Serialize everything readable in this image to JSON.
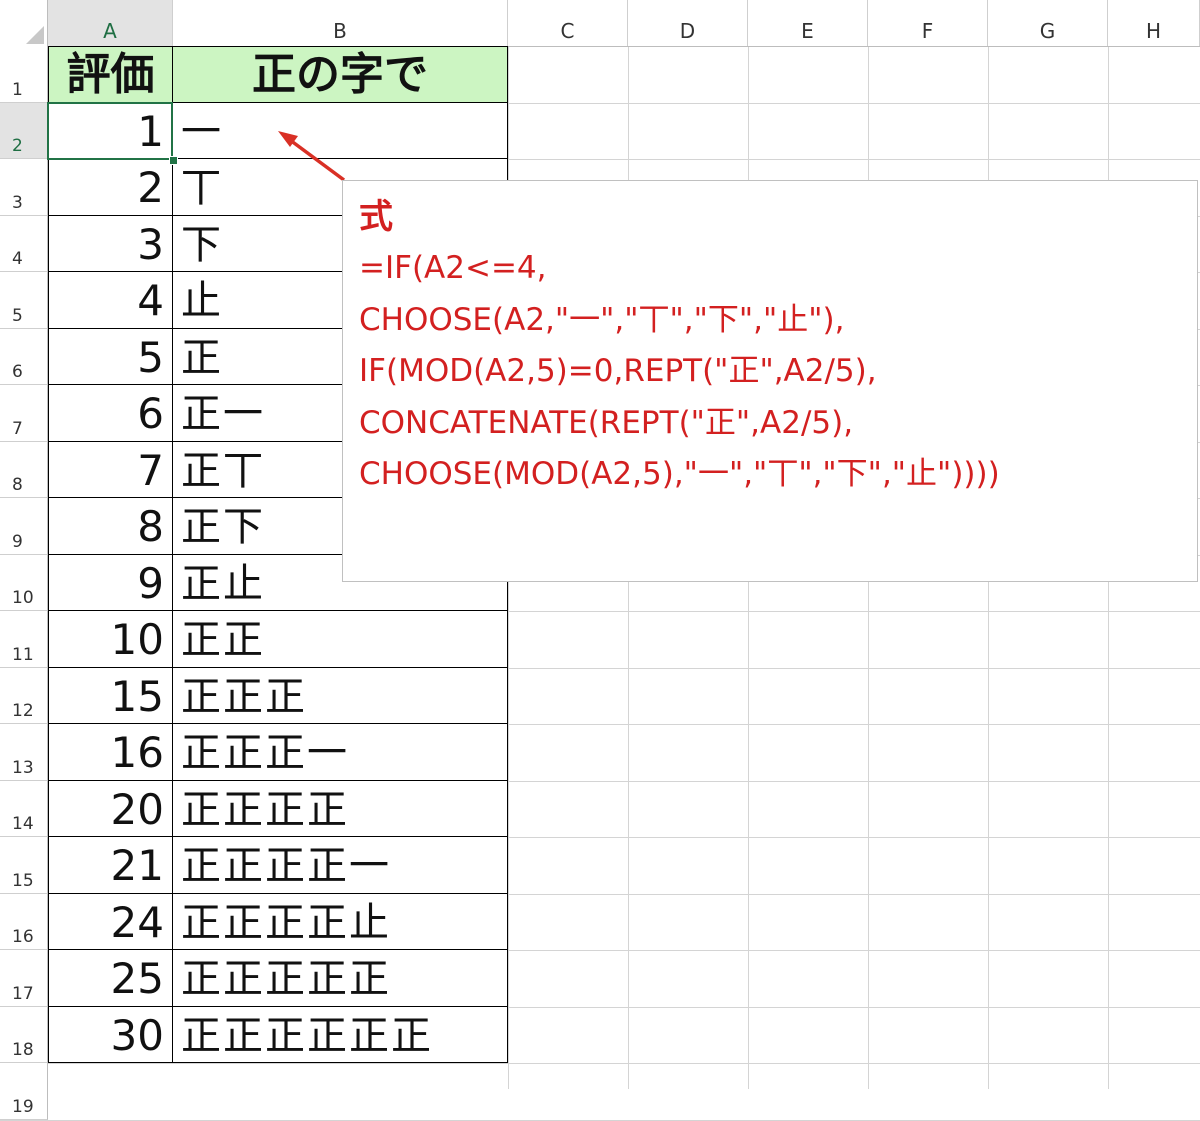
{
  "columns": [
    "A",
    "B",
    "C",
    "D",
    "E",
    "F",
    "G",
    "H"
  ],
  "rows": [
    "1",
    "2",
    "3",
    "4",
    "5",
    "6",
    "7",
    "8",
    "9",
    "10",
    "11",
    "12",
    "13",
    "14",
    "15",
    "16",
    "17",
    "18",
    "19"
  ],
  "table": {
    "header": {
      "rating": "評価",
      "tally": "正の字で"
    },
    "data": [
      {
        "value": "1",
        "tally": "一"
      },
      {
        "value": "2",
        "tally": "丅"
      },
      {
        "value": "3",
        "tally": "下"
      },
      {
        "value": "4",
        "tally": "止"
      },
      {
        "value": "5",
        "tally": "正"
      },
      {
        "value": "6",
        "tally": "正一"
      },
      {
        "value": "7",
        "tally": "正丅"
      },
      {
        "value": "8",
        "tally": "正下"
      },
      {
        "value": "9",
        "tally": "正止"
      },
      {
        "value": "10",
        "tally": "正正"
      },
      {
        "value": "15",
        "tally": "正正正"
      },
      {
        "value": "16",
        "tally": "正正正一"
      },
      {
        "value": "20",
        "tally": "正正正正"
      },
      {
        "value": "21",
        "tally": "正正正正一"
      },
      {
        "value": "24",
        "tally": "正正正正止"
      },
      {
        "value": "25",
        "tally": "正正正正正"
      },
      {
        "value": "30",
        "tally": "正正正正正正"
      }
    ]
  },
  "annotation": {
    "title": "式",
    "lines": [
      "=IF(A2<=4,",
      "CHOOSE(A2,\"一\",\"丅\",\"下\",\"止\"),",
      "IF(MOD(A2,5)=0,REPT(\"正\",A2/5),",
      "CONCATENATE(REPT(\"正\",A2/5),",
      "CHOOSE(MOD(A2,5),\"一\",\"丅\",\"下\",\"止\"))))"
    ]
  },
  "selected_cell": "A2",
  "colors": {
    "header_fill": "#ccf5c2",
    "annotation_text": "#d32020",
    "selection": "#217346"
  }
}
